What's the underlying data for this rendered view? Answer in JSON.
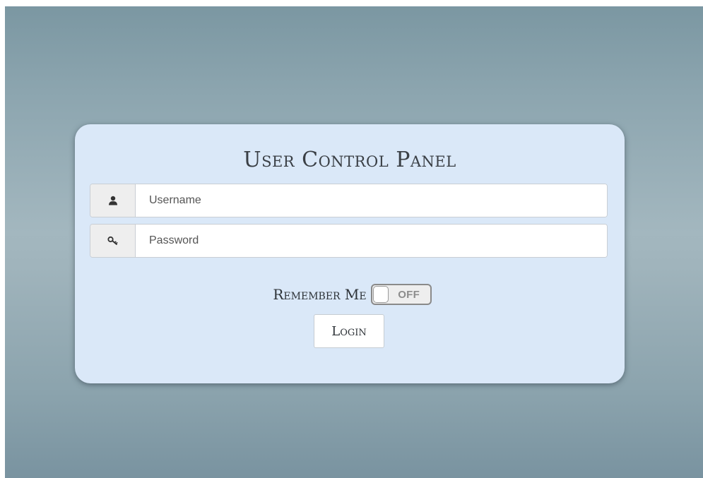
{
  "panel": {
    "title": "User Control Panel"
  },
  "form": {
    "username": {
      "placeholder": "Username",
      "value": "",
      "icon": "user-icon"
    },
    "password": {
      "placeholder": "Password",
      "value": "",
      "icon": "key-icon"
    },
    "remember": {
      "label": "Remember Me",
      "state_text": "OFF",
      "checked": false
    },
    "login_label": "Login"
  },
  "colors": {
    "panel_background": "#dae8f8",
    "backdrop": "#a3b7bf",
    "addon_background": "#eeeeee",
    "toggle_text": "#8c8c8c"
  }
}
